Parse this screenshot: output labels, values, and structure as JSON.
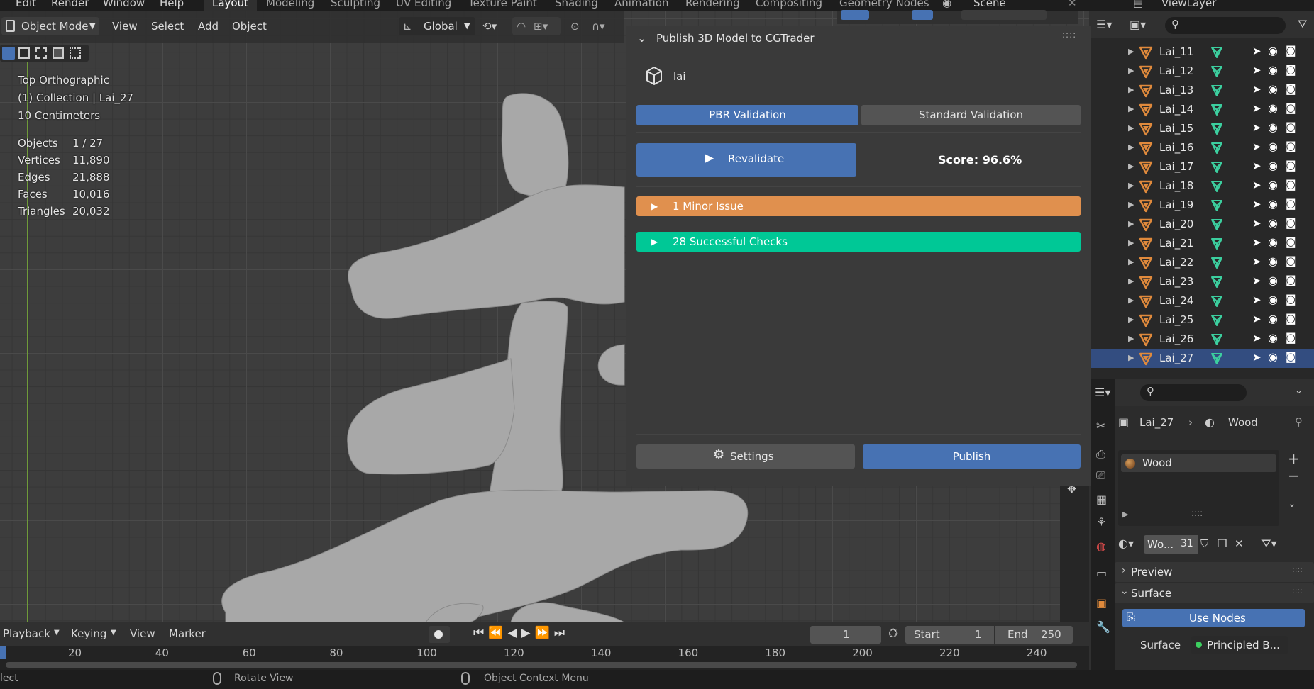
{
  "top_menu": [
    "Edit",
    "Render",
    "Window",
    "Help"
  ],
  "workspaces": [
    "Layout",
    "Modeling",
    "Sculpting",
    "UV Editing",
    "Texture Paint",
    "Shading",
    "Animation",
    "Rendering",
    "Compositing",
    "Geometry Nodes"
  ],
  "scene_name": "Scene",
  "view_layer_name": "ViewLayer",
  "viewport_header": {
    "mode": "Object Mode",
    "menus": [
      "View",
      "Select",
      "Add",
      "Object"
    ],
    "transform_orientation": "Global"
  },
  "viewport_overlay": {
    "view_name": "Top Orthographic",
    "collection_info": "(1) Collection | Lai_27",
    "scale_info": "10 Centimeters",
    "stats": [
      {
        "label": "Objects",
        "value": "1 / 27"
      },
      {
        "label": "Vertices",
        "value": "11,890"
      },
      {
        "label": "Edges",
        "value": "21,888"
      },
      {
        "label": "Faces",
        "value": "10,016"
      },
      {
        "label": "Triangles",
        "value": "20,032"
      }
    ]
  },
  "cg_panel": {
    "title": "Publish 3D Model to CGTrader",
    "model_name": "lai",
    "tabs": [
      {
        "label": "PBR Validation",
        "active": true
      },
      {
        "label": "Standard Validation",
        "active": false
      }
    ],
    "revalidate_label": "Revalidate",
    "score": "Score: 96.6%",
    "issues": [
      {
        "label": "1 Minor Issue",
        "color": "#e0904e"
      },
      {
        "label": "28 Successful Checks",
        "color": "#00c896"
      }
    ],
    "settings_label": "Settings",
    "publish_label": "Publish"
  },
  "outliner": {
    "items": [
      "Lai_11",
      "Lai_12",
      "Lai_13",
      "Lai_14",
      "Lai_15",
      "Lai_16",
      "Lai_17",
      "Lai_18",
      "Lai_19",
      "Lai_20",
      "Lai_21",
      "Lai_22",
      "Lai_23",
      "Lai_24",
      "Lai_25",
      "Lai_26",
      "Lai_27"
    ],
    "selected": "Lai_27"
  },
  "properties": {
    "breadcrumb_object": "Lai_27",
    "breadcrumb_material": "Wood",
    "material_slot": "Wood",
    "material_name_short": "Wo...",
    "material_users": "31",
    "sections": [
      "Preview",
      "Surface"
    ],
    "use_nodes_label": "Use Nodes",
    "surface_label": "Surface",
    "surface_value": "Principled B..."
  },
  "timeline": {
    "menus": [
      "Playback",
      "Keying",
      "View",
      "Marker"
    ],
    "current_frame": "1",
    "start_label": "Start",
    "start_value": "1",
    "end_label": "End",
    "end_value": "250",
    "ruler_ticks": [
      "20",
      "40",
      "60",
      "80",
      "100",
      "120",
      "140",
      "160",
      "180",
      "200",
      "220",
      "240"
    ]
  },
  "status_bar": {
    "left_hint": "lect",
    "middle_hint": "Rotate View",
    "right_hint": "Object Context Menu"
  },
  "colors": {
    "accent_blue": "#4772b3",
    "minor_issue": "#e0904e",
    "success": "#00c896",
    "object_orange": "#e08a3c",
    "mesh_green": "#3ccf9f",
    "selection": "#334d80"
  }
}
